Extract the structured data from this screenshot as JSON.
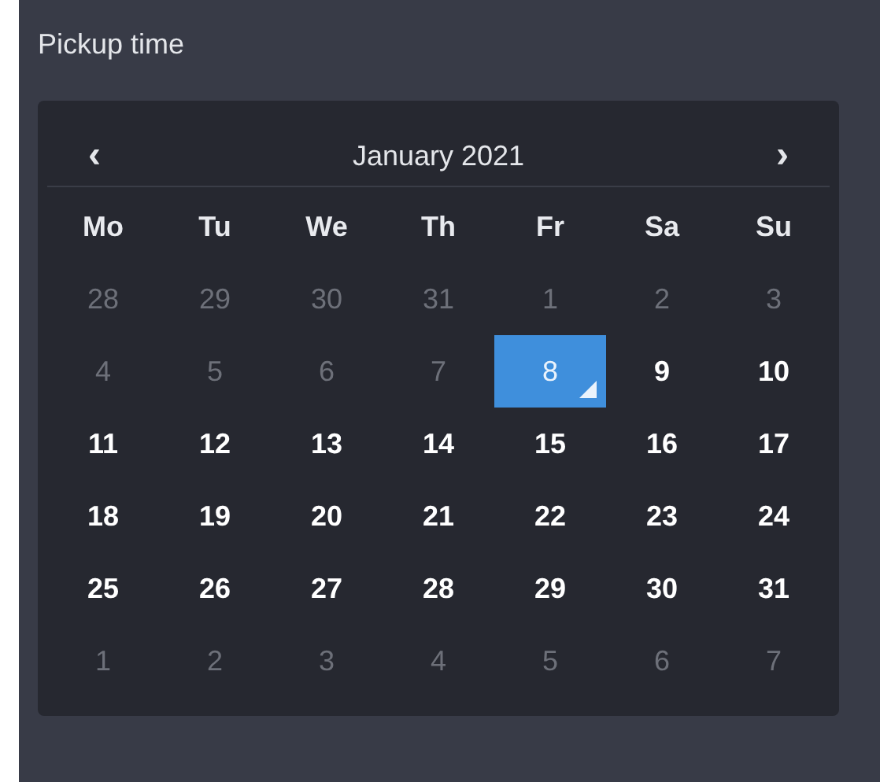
{
  "label": "Pickup time",
  "calendar": {
    "prev": "‹",
    "title": "January 2021",
    "next": "›",
    "weekdays": [
      "Mo",
      "Tu",
      "We",
      "Th",
      "Fr",
      "Sa",
      "Su"
    ],
    "weeks": [
      [
        {
          "day": "28",
          "disabled": true,
          "selected": false
        },
        {
          "day": "29",
          "disabled": true,
          "selected": false
        },
        {
          "day": "30",
          "disabled": true,
          "selected": false
        },
        {
          "day": "31",
          "disabled": true,
          "selected": false
        },
        {
          "day": "1",
          "disabled": true,
          "selected": false
        },
        {
          "day": "2",
          "disabled": true,
          "selected": false
        },
        {
          "day": "3",
          "disabled": true,
          "selected": false
        }
      ],
      [
        {
          "day": "4",
          "disabled": true,
          "selected": false
        },
        {
          "day": "5",
          "disabled": true,
          "selected": false
        },
        {
          "day": "6",
          "disabled": true,
          "selected": false
        },
        {
          "day": "7",
          "disabled": true,
          "selected": false
        },
        {
          "day": "8",
          "disabled": false,
          "selected": true
        },
        {
          "day": "9",
          "disabled": false,
          "selected": false
        },
        {
          "day": "10",
          "disabled": false,
          "selected": false
        }
      ],
      [
        {
          "day": "11",
          "disabled": false,
          "selected": false
        },
        {
          "day": "12",
          "disabled": false,
          "selected": false
        },
        {
          "day": "13",
          "disabled": false,
          "selected": false
        },
        {
          "day": "14",
          "disabled": false,
          "selected": false
        },
        {
          "day": "15",
          "disabled": false,
          "selected": false
        },
        {
          "day": "16",
          "disabled": false,
          "selected": false
        },
        {
          "day": "17",
          "disabled": false,
          "selected": false
        }
      ],
      [
        {
          "day": "18",
          "disabled": false,
          "selected": false
        },
        {
          "day": "19",
          "disabled": false,
          "selected": false
        },
        {
          "day": "20",
          "disabled": false,
          "selected": false
        },
        {
          "day": "21",
          "disabled": false,
          "selected": false
        },
        {
          "day": "22",
          "disabled": false,
          "selected": false
        },
        {
          "day": "23",
          "disabled": false,
          "selected": false
        },
        {
          "day": "24",
          "disabled": false,
          "selected": false
        }
      ],
      [
        {
          "day": "25",
          "disabled": false,
          "selected": false
        },
        {
          "day": "26",
          "disabled": false,
          "selected": false
        },
        {
          "day": "27",
          "disabled": false,
          "selected": false
        },
        {
          "day": "28",
          "disabled": false,
          "selected": false
        },
        {
          "day": "29",
          "disabled": false,
          "selected": false
        },
        {
          "day": "30",
          "disabled": false,
          "selected": false
        },
        {
          "day": "31",
          "disabled": false,
          "selected": false
        }
      ],
      [
        {
          "day": "1",
          "disabled": true,
          "selected": false
        },
        {
          "day": "2",
          "disabled": true,
          "selected": false
        },
        {
          "day": "3",
          "disabled": true,
          "selected": false
        },
        {
          "day": "4",
          "disabled": true,
          "selected": false
        },
        {
          "day": "5",
          "disabled": true,
          "selected": false
        },
        {
          "day": "6",
          "disabled": true,
          "selected": false
        },
        {
          "day": "7",
          "disabled": true,
          "selected": false
        }
      ]
    ]
  }
}
